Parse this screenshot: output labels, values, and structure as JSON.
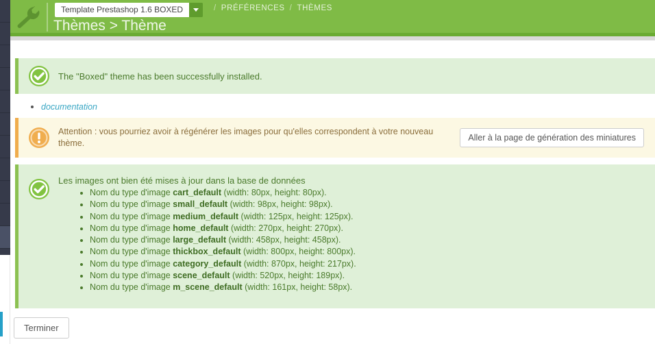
{
  "header": {
    "wrench_icon": "wrench-icon",
    "theme_select_value": "Template Prestashop 1.6 BOXED",
    "breadcrumb": {
      "sep1": "/",
      "item1": "PRÉFÉRENCES",
      "sep2": "/",
      "item2": "THÈMES"
    },
    "page_title": "Thèmes > Thème",
    "colors": {
      "header_green": "#7fbb46",
      "header_underline": "#6aab33",
      "select_caret_bg": "#5f9c2d"
    }
  },
  "alerts": {
    "installed": {
      "icon": "check-circle-icon",
      "text": "The \"Boxed\" theme has been successfully installed.",
      "accent": "#8cc152",
      "bg": "#dff0d8"
    },
    "regenerate": {
      "icon": "exclamation-circle-icon",
      "text": "Attention : vous pourriez avoir à régénérer les images pour qu'elles correspondent à votre nouveau thème.",
      "button_label": "Aller à la page de génération des miniatures",
      "accent": "#f0ad4e",
      "bg": "#fcf8e3"
    },
    "images_updated": {
      "icon": "check-circle-icon",
      "heading": "Les images ont bien été mises à jour dans la base de données",
      "accent": "#8cc152",
      "bg": "#dff0d8",
      "items": [
        {
          "prefix": "Nom du type d'image",
          "name": "cart_default",
          "dims": "(width: 80px, height: 80px)."
        },
        {
          "prefix": "Nom du type d'image",
          "name": "small_default",
          "dims": "(width: 98px, height: 98px)."
        },
        {
          "prefix": "Nom du type d'image",
          "name": "medium_default",
          "dims": "(width: 125px, height: 125px)."
        },
        {
          "prefix": "Nom du type d'image",
          "name": "home_default",
          "dims": "(width: 270px, height: 270px)."
        },
        {
          "prefix": "Nom du type d'image",
          "name": "large_default",
          "dims": "(width: 458px, height: 458px)."
        },
        {
          "prefix": "Nom du type d'image",
          "name": "thickbox_default",
          "dims": "(width: 800px, height: 800px)."
        },
        {
          "prefix": "Nom du type d'image",
          "name": "category_default",
          "dims": "(width: 870px, height: 217px)."
        },
        {
          "prefix": "Nom du type d'image",
          "name": "scene_default",
          "dims": "(width: 520px, height: 189px)."
        },
        {
          "prefix": "Nom du type d'image",
          "name": "m_scene_default",
          "dims": "(width: 161px, height: 58px)."
        }
      ]
    }
  },
  "documentation_link": {
    "label": "documentation",
    "color": "#3aa7c4"
  },
  "footer": {
    "finish_button_label": "Terminer"
  },
  "sidebar": {
    "strip_color": "#363a4a",
    "active_color": "#4a5166",
    "accent_color": "#25a0c8"
  }
}
